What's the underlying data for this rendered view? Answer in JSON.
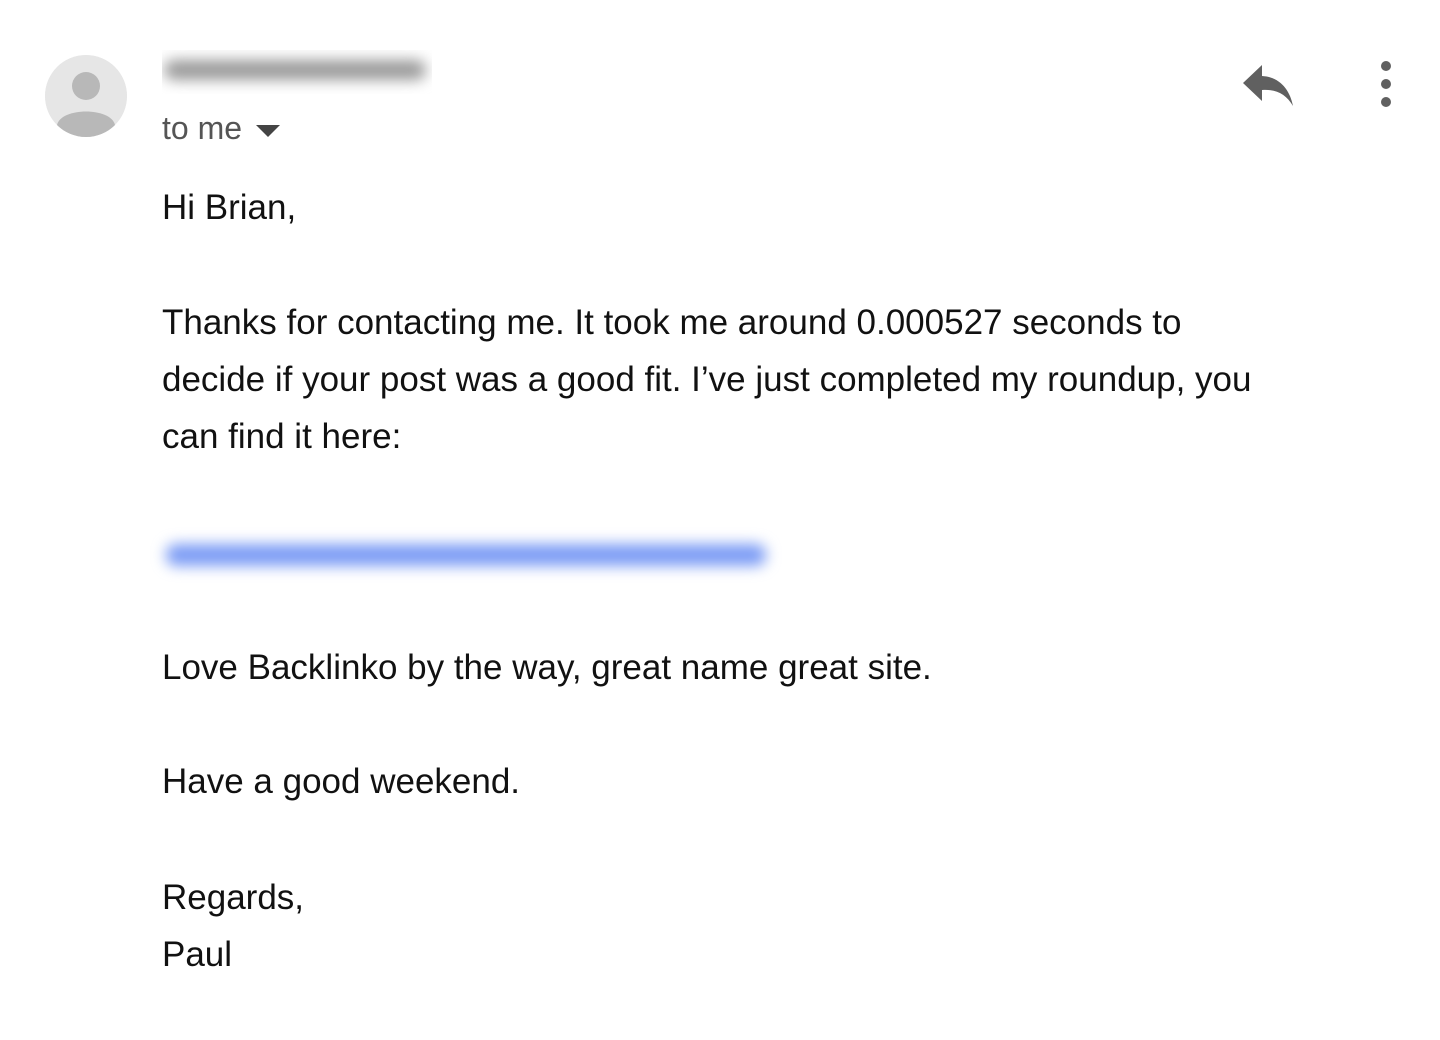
{
  "header": {
    "recipient_label": "to me",
    "icons": {
      "avatar": "person-avatar-icon",
      "reply": "reply-icon",
      "more": "more-vertical-icon",
      "caret": "caret-down-icon"
    }
  },
  "message": {
    "greeting": "Hi Brian,",
    "paragraph_1_line_1": "Thanks for contacting me. It took me around 0.000527 seconds to",
    "paragraph_1_line_2": "decide if your post was a good fit. I’ve just completed my roundup, you",
    "paragraph_1_line_3": "can find it here:",
    "paragraph_2": "Love Backlinko by the way, great name great site.",
    "paragraph_3": "Have a good weekend.",
    "signoff": "Regards,",
    "signature": "Paul"
  },
  "colors": {
    "link_blur": "#7c9cf5",
    "icon_gray": "#606060",
    "text": "#111111",
    "secondary_text": "#555555"
  }
}
